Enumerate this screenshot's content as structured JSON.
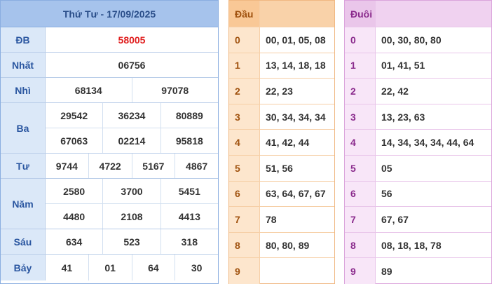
{
  "results": {
    "title": "Thứ Tư - 17/09/2025",
    "special_color": "#e01e1e",
    "rows": [
      {
        "label": "ĐB",
        "lines": [
          [
            "58005"
          ]
        ]
      },
      {
        "label": "Nhất",
        "lines": [
          [
            "06756"
          ]
        ]
      },
      {
        "label": "Nhì",
        "lines": [
          [
            "68134",
            "97078"
          ]
        ]
      },
      {
        "label": "Ba",
        "lines": [
          [
            "29542",
            "36234",
            "80889"
          ],
          [
            "67063",
            "02214",
            "95818"
          ]
        ]
      },
      {
        "label": "Tư",
        "lines": [
          [
            "9744",
            "4722",
            "5167",
            "4867"
          ]
        ]
      },
      {
        "label": "Năm",
        "lines": [
          [
            "2580",
            "3700",
            "5451"
          ],
          [
            "4480",
            "2108",
            "4413"
          ]
        ]
      },
      {
        "label": "Sáu",
        "lines": [
          [
            "634",
            "523",
            "318"
          ]
        ]
      },
      {
        "label": "Bảy",
        "lines": [
          [
            "41",
            "01",
            "64",
            "30"
          ]
        ]
      }
    ]
  },
  "dau": {
    "header": "Đầu",
    "rows": [
      {
        "digit": "0",
        "values": "00, 01, 05, 08"
      },
      {
        "digit": "1",
        "values": "13, 14, 18, 18"
      },
      {
        "digit": "2",
        "values": "22, 23"
      },
      {
        "digit": "3",
        "values": "30, 34, 34, 34"
      },
      {
        "digit": "4",
        "values": "41, 42, 44"
      },
      {
        "digit": "5",
        "values": "51, 56"
      },
      {
        "digit": "6",
        "values": "63, 64, 67, 67"
      },
      {
        "digit": "7",
        "values": "78"
      },
      {
        "digit": "8",
        "values": "80, 80, 89"
      },
      {
        "digit": "9",
        "values": ""
      }
    ]
  },
  "duoi": {
    "header": "Đuôi",
    "rows": [
      {
        "digit": "0",
        "values": "00, 30, 80, 80"
      },
      {
        "digit": "1",
        "values": "01, 41, 51"
      },
      {
        "digit": "2",
        "values": "22, 42"
      },
      {
        "digit": "3",
        "values": "13, 23, 63"
      },
      {
        "digit": "4",
        "values": "14, 34, 34, 34, 44, 64"
      },
      {
        "digit": "5",
        "values": "05"
      },
      {
        "digit": "6",
        "values": "56"
      },
      {
        "digit": "7",
        "values": "67, 67"
      },
      {
        "digit": "8",
        "values": "08, 18, 18, 78"
      },
      {
        "digit": "9",
        "values": "89"
      }
    ]
  }
}
